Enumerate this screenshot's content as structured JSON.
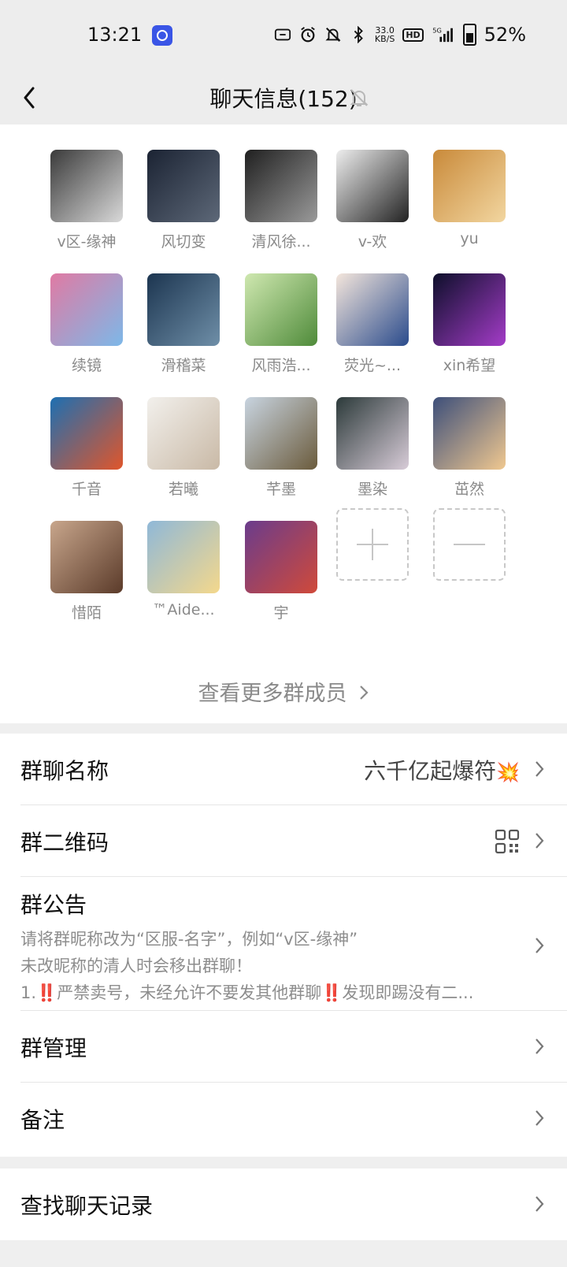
{
  "status_bar": {
    "time": "13:21",
    "net_speed_top": "33.0",
    "net_speed_unit": "KB/S",
    "hd": "HD",
    "network": "5G",
    "battery": "52%",
    "icons": [
      "zalo-app-icon",
      "nfc-icon",
      "alarm-icon",
      "mute-bell-icon",
      "bluetooth-icon",
      "signal-icon",
      "battery-icon"
    ]
  },
  "nav": {
    "title": "聊天信息(152)",
    "back_icon": "chevron-left-icon",
    "mute_icon": "bell-off-icon"
  },
  "members": [
    {
      "name": "v区-缘神",
      "avatar_colors": [
        "#3a3a3a",
        "#d9d9d9"
      ]
    },
    {
      "name": "风切变",
      "avatar_colors": [
        "#1b2333",
        "#5d6878"
      ]
    },
    {
      "name": "清风徐...",
      "avatar_colors": [
        "#202020",
        "#9a9a9a"
      ]
    },
    {
      "name": "v-欢",
      "avatar_colors": [
        "#eeeeee",
        "#222222"
      ]
    },
    {
      "name": "yu",
      "avatar_colors": [
        "#c98a3a",
        "#f2d6a0"
      ]
    },
    {
      "name": "续镜",
      "avatar_colors": [
        "#e07aa3",
        "#7db8e8"
      ]
    },
    {
      "name": "滑稽菜",
      "avatar_colors": [
        "#1c3550",
        "#6f8fa8"
      ]
    },
    {
      "name": "风雨浩...",
      "avatar_colors": [
        "#cfe8b0",
        "#4f8b3a"
      ]
    },
    {
      "name": "荧光~...",
      "avatar_colors": [
        "#f4e6dc",
        "#2a4b8c"
      ]
    },
    {
      "name": "xin希望",
      "avatar_colors": [
        "#0d0f2a",
        "#a43cc8"
      ]
    },
    {
      "name": "千音",
      "avatar_colors": [
        "#1d6fb2",
        "#e0562b"
      ]
    },
    {
      "name": "若曦",
      "avatar_colors": [
        "#f2f0ec",
        "#c9b9a6"
      ]
    },
    {
      "name": "芊墨",
      "avatar_colors": [
        "#c8d4e0",
        "#6b5b3c"
      ]
    },
    {
      "name": "墨染",
      "avatar_colors": [
        "#2c3a3a",
        "#d8ccd8"
      ]
    },
    {
      "name": "茁然",
      "avatar_colors": [
        "#3d4f7a",
        "#f0c890"
      ]
    },
    {
      "name": "惜陌",
      "avatar_colors": [
        "#c8a68c",
        "#5b3b2a"
      ]
    },
    {
      "name": "™Aide...",
      "avatar_colors": [
        "#8fb8d8",
        "#f4d88c"
      ]
    },
    {
      "name": "宇",
      "avatar_colors": [
        "#6a3c8c",
        "#d04a3a"
      ]
    }
  ],
  "member_actions": {
    "add_icon": "plus-icon",
    "remove_icon": "minus-icon"
  },
  "more_members": "查看更多群成员",
  "settings": {
    "group_name_label": "群聊名称",
    "group_name_value": "六千亿起爆符",
    "group_name_emoji": "💥",
    "qr_label": "群二维码",
    "notice_label": "群公告",
    "notice_line1": "请将群昵称改为“区服-名字”，例如“v区-缘神”",
    "notice_line2": "未改昵称的清人时会移出群聊！",
    "notice_line3_prefix": "1.",
    "notice_line3_mid": "严禁卖号，未经允许不要发其他群聊",
    "notice_line3_suffix": "发现即踢没有二...",
    "notice_bang": "‼️",
    "manage_label": "群管理",
    "remark_label": "备注",
    "search_history_label": "查找聊天记录"
  }
}
